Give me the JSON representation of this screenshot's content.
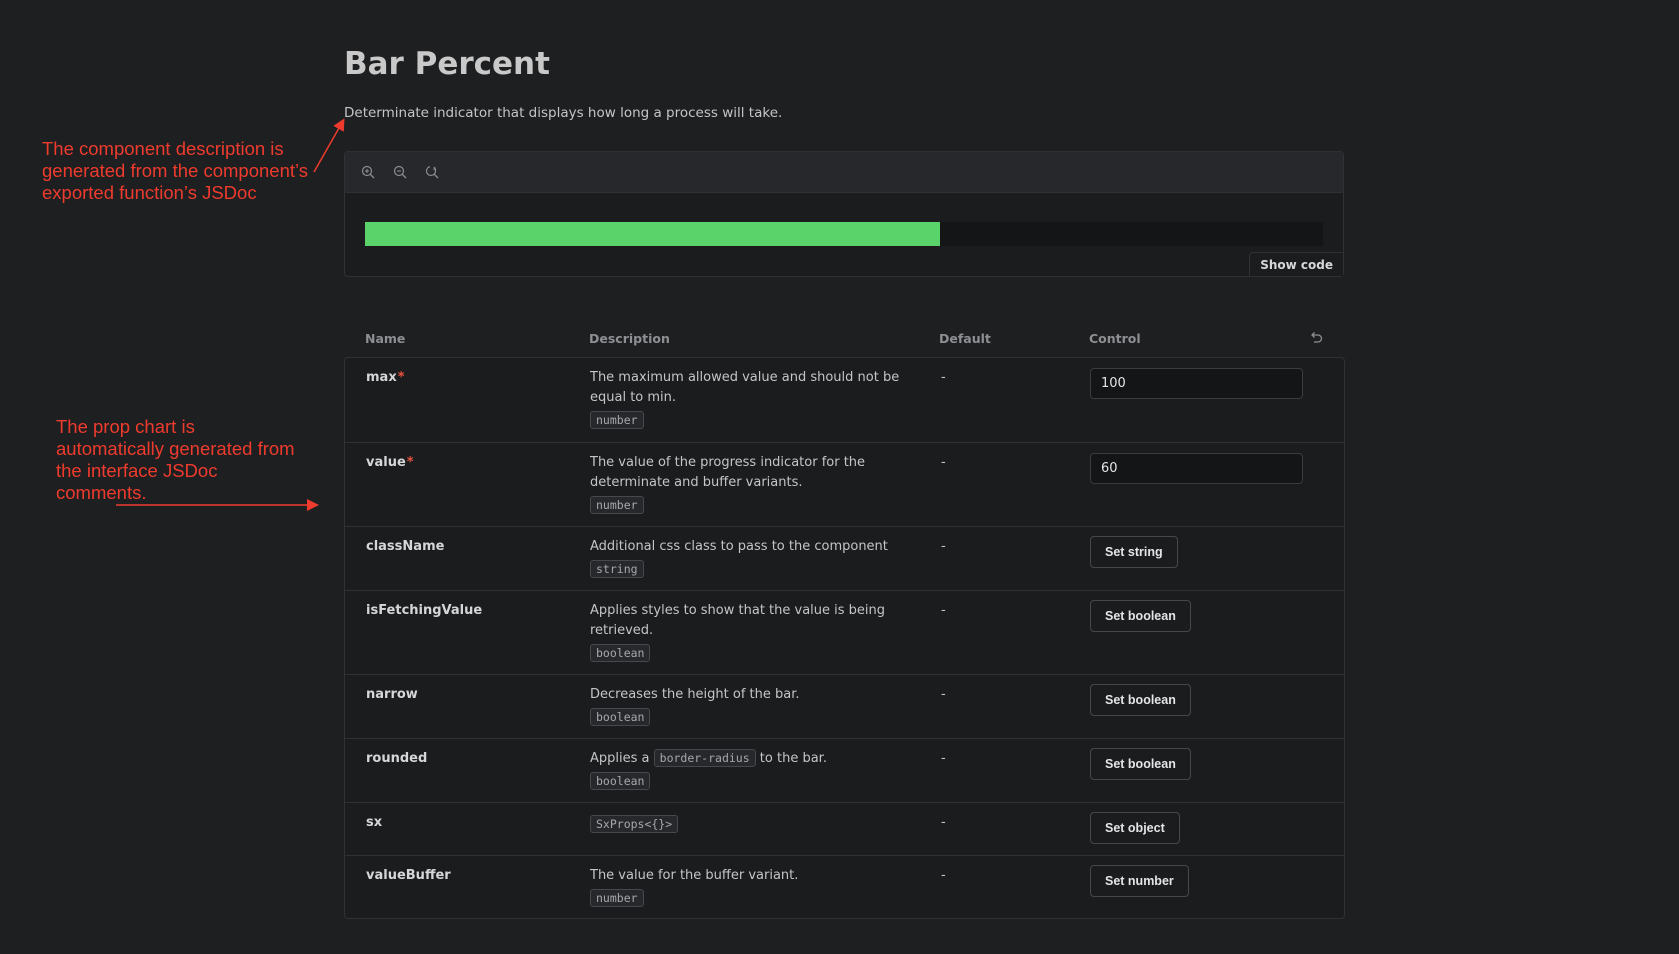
{
  "annotations": {
    "description_note": "The component description is generated from the component’s exported function’s JSDoc",
    "propchart_note": "The prop chart is automatically generated from the interface JSDoc comments."
  },
  "page": {
    "title": "Bar Percent",
    "description": "Determinate indicator that displays how long a process will take."
  },
  "preview": {
    "toolbar": [
      {
        "icon": "zoom-in-icon"
      },
      {
        "icon": "zoom-out-icon"
      },
      {
        "icon": "reset-zoom-icon"
      }
    ],
    "bar_progress": 0.6,
    "bar_color": "#5bd36b",
    "show_code_label": "Show code"
  },
  "props_table": {
    "headers": {
      "name": "Name",
      "description": "Description",
      "default": "Default",
      "control": "Control"
    },
    "reset_icon": "undo-icon",
    "rows": [
      {
        "name": "max",
        "required": "*",
        "description": "The maximum allowed value and should not be equal to min.",
        "type": "number",
        "default": "-",
        "control_value": "100"
      },
      {
        "name": "value",
        "required": "*",
        "description": "The value of the progress indicator for the determinate and buffer variants.",
        "type": "number",
        "default": "-",
        "control_value": "60"
      },
      {
        "name": "className",
        "description": "Additional css class to pass to the component",
        "type": "string",
        "default": "-",
        "control_label": "Set string"
      },
      {
        "name": "isFetchingValue",
        "description": "Applies styles to show that the value is being retrieved.",
        "type": "boolean",
        "default": "-",
        "control_label": "Set boolean"
      },
      {
        "name": "narrow",
        "description": "Decreases the height of the bar.",
        "type": "boolean",
        "default": "-",
        "control_label": "Set boolean"
      },
      {
        "name": "rounded",
        "description_before": "Applies a",
        "description_code": "border-radius",
        "description_after": "to the bar.",
        "type": "boolean",
        "default": "-",
        "control_label": "Set boolean"
      },
      {
        "name": "sx",
        "type": "SxProps<{}>",
        "default": "-",
        "control_label": "Set object"
      },
      {
        "name": "valueBuffer",
        "description": "The value for the buffer variant.",
        "type": "number",
        "default": "-",
        "control_label": "Set number"
      }
    ]
  }
}
